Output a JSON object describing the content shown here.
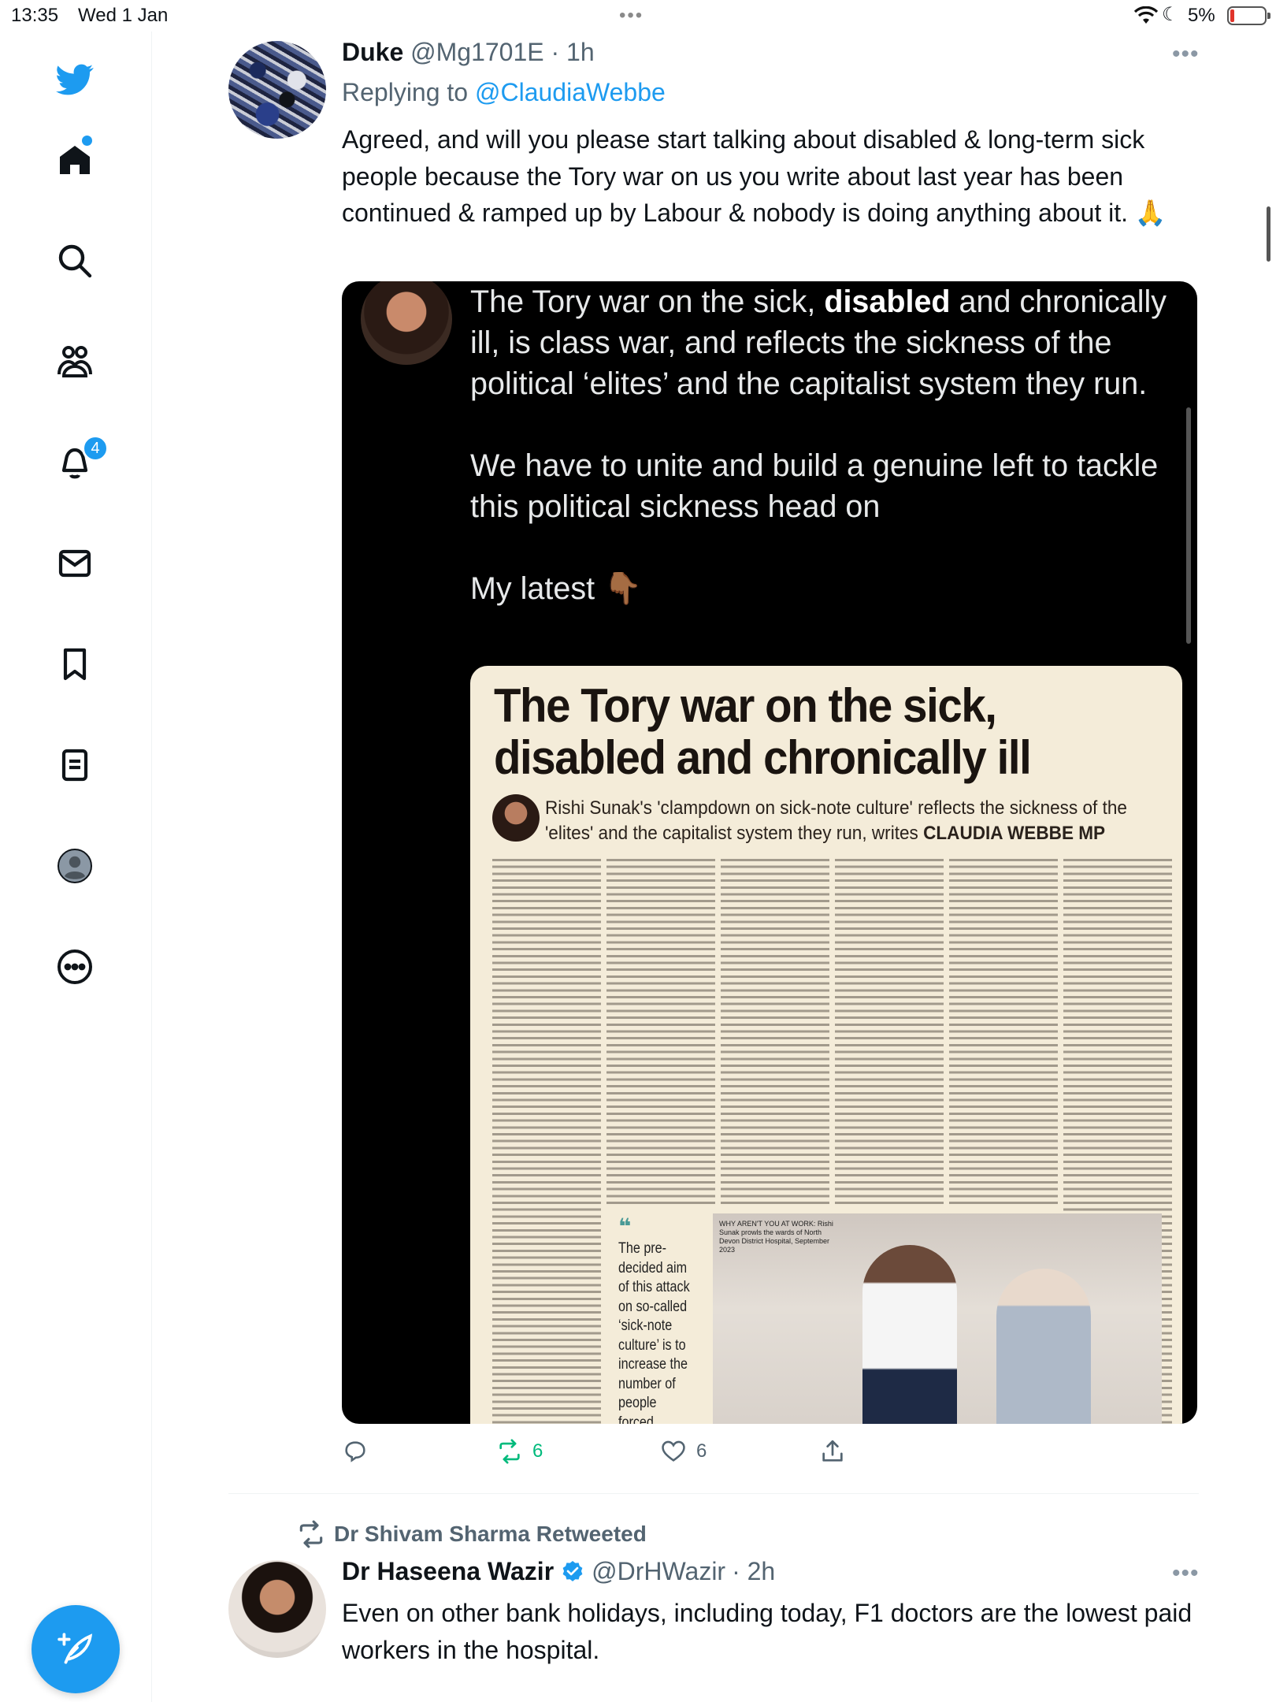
{
  "status_bar": {
    "time": "13:35",
    "date": "Wed 1 Jan",
    "multitask": "•••",
    "battery": "5%"
  },
  "sidebar": {
    "items": [
      {
        "icon": "twitter-logo-icon"
      },
      {
        "icon": "home-icon"
      },
      {
        "icon": "search-icon"
      },
      {
        "icon": "communities-icon"
      },
      {
        "icon": "bell-icon"
      },
      {
        "icon": "mail-icon"
      },
      {
        "icon": "bookmark-icon"
      },
      {
        "icon": "lists-icon"
      },
      {
        "icon": "profile-icon"
      },
      {
        "icon": "more-icon"
      }
    ],
    "notification_count": "4",
    "compose_icon": "feather-plus-icon"
  },
  "tweet1": {
    "name": "Duke",
    "handle": "@Mg1701E",
    "time": "· 1h",
    "replying_prefix": "Replying to",
    "replying_to": "@ClaudiaWebbe",
    "more": "•••",
    "text": "Agreed, and will you please start talking about disabled & long-term sick people because the Tory war on us you write about last year has been continued & ramped up by Labour & nobody is doing anything about it. 🙏",
    "media": {
      "line1_a": "The Tory war on the sick, ",
      "line1_bold": "disabled",
      "line1_b": " and chronically ill, is class war, and reflects the sickness of the political ‘elites’ and the capitalist system they run.",
      "para2": "We have to unite and build a genuine left to tackle this political sickness head on",
      "para3": "My latest 👇🏾",
      "article": {
        "headline": "The Tory war on the sick, disabled and chronically ill",
        "standfirst": "Rishi Sunak's 'clampdown on sick-note culture' reflects the sickness of the 'elites' and the capitalist system they run, writes ",
        "author": "CLAUDIA WEBBE MP",
        "pullquote": "The pre-decided aim of this attack on so-called ‘sick-note culture’ is to increase the number of people forced",
        "photo_caption": "WHY AREN'T YOU AT WORK: Rishi Sunak prowls the wards of North Devon District Hospital, September 2023"
      }
    },
    "actions": {
      "reply": "",
      "retweets": "6",
      "likes": "6",
      "share": ""
    }
  },
  "tweet2": {
    "retweeted_by": "Dr Shivam Sharma Retweeted",
    "name": "Dr Haseena Wazir",
    "verified": true,
    "handle": "@DrHWazir",
    "time": "· 2h",
    "more": "•••",
    "text": "Even on other bank holidays, including today, F1 doctors are the lowest paid workers in the hospital."
  },
  "colors": {
    "accent": "#1d9bf0",
    "retweet": "#00ba7c",
    "secondary_text": "#536471"
  }
}
